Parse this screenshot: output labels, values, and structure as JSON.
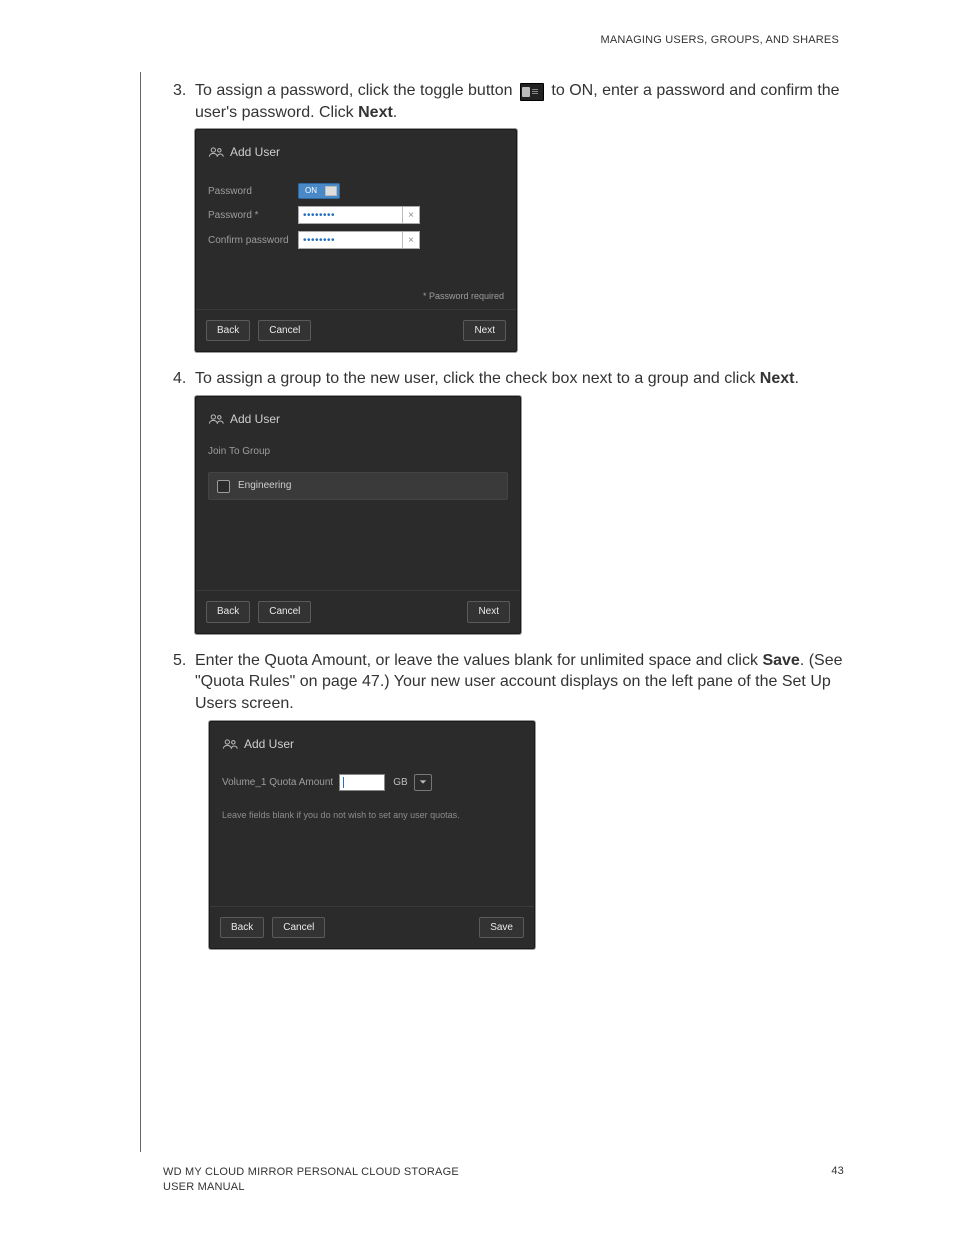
{
  "header": {
    "section_title": "MANAGING USERS, GROUPS, AND SHARES"
  },
  "footer": {
    "product": "WD MY CLOUD MIRROR PERSONAL CLOUD STORAGE",
    "doc": "USER MANUAL",
    "page": "43"
  },
  "step3": {
    "text_a": "To assign a password, click the toggle button",
    "text_b": "to ON, enter a password and confirm the user's password. Click ",
    "next": "Next",
    "period": "."
  },
  "step4": {
    "text": "To assign a group to the new user, click the check box next to a group and click ",
    "next": "Next",
    "period": "."
  },
  "step5": {
    "text_a": "Enter the Quota Amount, or leave the values blank for unlimited space and click ",
    "save": "Save",
    "period1": ".",
    "text_b": " (See \"Quota Rules\" on page 47.) Your new user account displays on the left pane of the Set Up Users screen."
  },
  "dlg_password": {
    "title": "Add User",
    "label_password": "Password",
    "toggle_state": "ON",
    "label_password_req": "Password *",
    "label_confirm": "Confirm password",
    "masked_value": "••••••••",
    "clear_symbol": "×",
    "note": "* Password required",
    "btn_back": "Back",
    "btn_cancel": "Cancel",
    "btn_next": "Next"
  },
  "dlg_group": {
    "title": "Add User",
    "subtitle": "Join To Group",
    "group_name": "Engineering",
    "btn_back": "Back",
    "btn_cancel": "Cancel",
    "btn_next": "Next"
  },
  "dlg_quota": {
    "title": "Add User",
    "label": "Volume_1 Quota Amount",
    "unit": "GB",
    "hint": "Leave fields blank if you do not wish to set any user quotas.",
    "btn_back": "Back",
    "btn_cancel": "Cancel",
    "btn_save": "Save"
  }
}
